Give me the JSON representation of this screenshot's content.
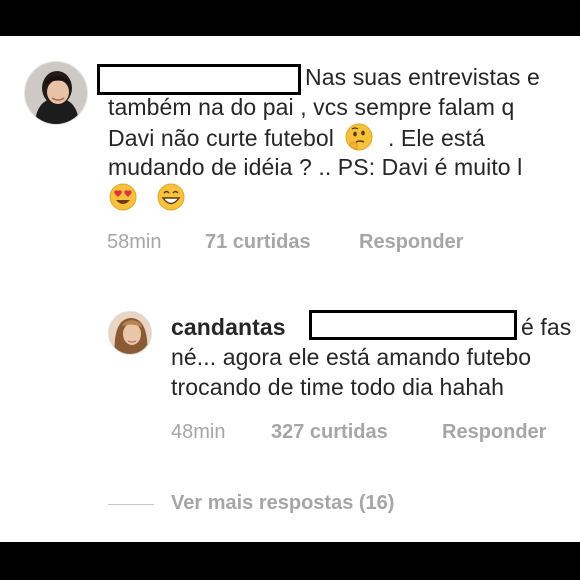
{
  "comment": {
    "avatar_icon": "user-avatar-photo",
    "lines": [
      "Nas suas entrevistas e",
      "também na do pai , vcs sempre falam q",
      "Davi não curte futebol",
      ". Ele está",
      "mudando de idéia ? .. PS: Davi é muito l"
    ],
    "emoji_thinking": "thinking-face-emoji",
    "emoji_heart_eyes": "heart-eyes-emoji",
    "emoji_grin": "grinning-face-emoji",
    "time": "58min",
    "likes": "71 curtidas",
    "reply_label": "Responder"
  },
  "reply": {
    "username": "candantas",
    "line1_end": "é fas",
    "line2": "né... agora ele está amando futebo",
    "line3": "trocando de time todo dia hahah",
    "time": "48min",
    "likes": "327 curtidas",
    "reply_label": "Responder"
  },
  "more_replies_label": "Ver mais respostas (16)",
  "colors": {
    "text": "#262626",
    "meta": "#a6a6a6",
    "background": "#ffffff",
    "bars": "#000000"
  }
}
